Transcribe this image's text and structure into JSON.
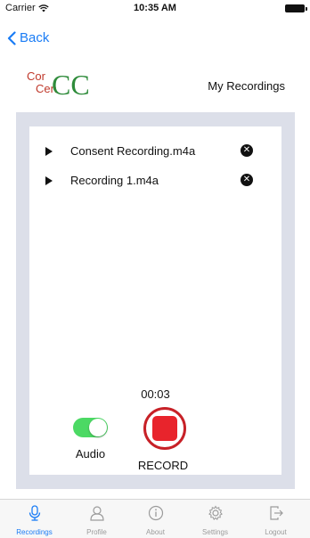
{
  "status_bar": {
    "carrier": "Carrier",
    "time": "10:35 AM"
  },
  "nav": {
    "back_label": "Back"
  },
  "header": {
    "logo": {
      "line1": "Cor",
      "line2": "Cen",
      "big_c": "CC"
    },
    "title": "My Recordings"
  },
  "recordings": [
    {
      "name": "Consent Recording.m4a"
    },
    {
      "name": "Recording 1.m4a"
    }
  ],
  "recorder": {
    "timer": "00:03",
    "audio_label": "Audio",
    "audio_enabled": true,
    "record_label": "RECORD"
  },
  "tabs": [
    {
      "label": "Recordings",
      "icon": "microphone-icon",
      "active": true
    },
    {
      "label": "Profile",
      "icon": "person-icon",
      "active": false
    },
    {
      "label": "About",
      "icon": "info-icon",
      "active": false
    },
    {
      "label": "Settings",
      "icon": "gear-icon",
      "active": false
    },
    {
      "label": "Logout",
      "icon": "logout-icon",
      "active": false
    }
  ],
  "colors": {
    "accent": "#1a7cf5",
    "record_red": "#e8242c",
    "toggle_on": "#4cd964",
    "panel_bg": "#dcdfe9"
  }
}
